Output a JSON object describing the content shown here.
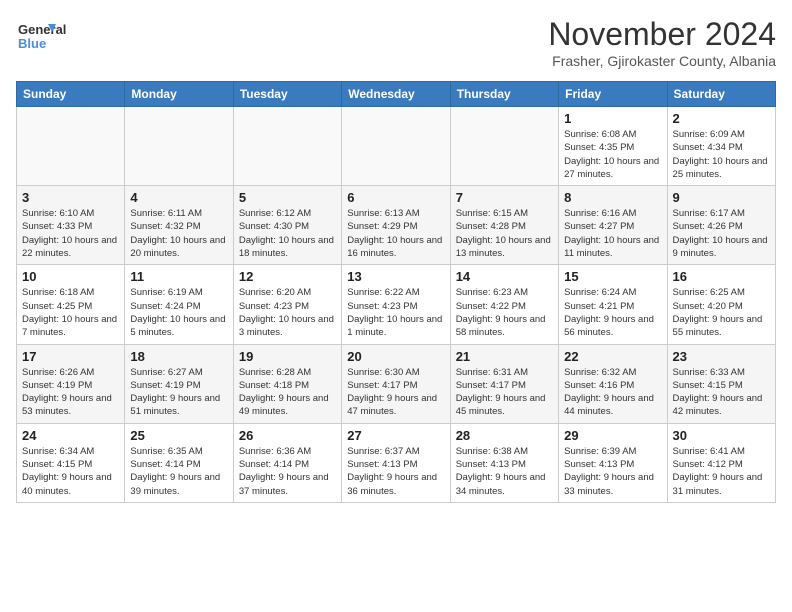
{
  "logo": {
    "line1": "General",
    "line2": "Blue"
  },
  "title": "November 2024",
  "location": "Frasher, Gjirokaster County, Albania",
  "headers": [
    "Sunday",
    "Monday",
    "Tuesday",
    "Wednesday",
    "Thursday",
    "Friday",
    "Saturday"
  ],
  "rows": [
    [
      {
        "day": "",
        "info": ""
      },
      {
        "day": "",
        "info": ""
      },
      {
        "day": "",
        "info": ""
      },
      {
        "day": "",
        "info": ""
      },
      {
        "day": "",
        "info": ""
      },
      {
        "day": "1",
        "info": "Sunrise: 6:08 AM\nSunset: 4:35 PM\nDaylight: 10 hours and 27 minutes."
      },
      {
        "day": "2",
        "info": "Sunrise: 6:09 AM\nSunset: 4:34 PM\nDaylight: 10 hours and 25 minutes."
      }
    ],
    [
      {
        "day": "3",
        "info": "Sunrise: 6:10 AM\nSunset: 4:33 PM\nDaylight: 10 hours and 22 minutes."
      },
      {
        "day": "4",
        "info": "Sunrise: 6:11 AM\nSunset: 4:32 PM\nDaylight: 10 hours and 20 minutes."
      },
      {
        "day": "5",
        "info": "Sunrise: 6:12 AM\nSunset: 4:30 PM\nDaylight: 10 hours and 18 minutes."
      },
      {
        "day": "6",
        "info": "Sunrise: 6:13 AM\nSunset: 4:29 PM\nDaylight: 10 hours and 16 minutes."
      },
      {
        "day": "7",
        "info": "Sunrise: 6:15 AM\nSunset: 4:28 PM\nDaylight: 10 hours and 13 minutes."
      },
      {
        "day": "8",
        "info": "Sunrise: 6:16 AM\nSunset: 4:27 PM\nDaylight: 10 hours and 11 minutes."
      },
      {
        "day": "9",
        "info": "Sunrise: 6:17 AM\nSunset: 4:26 PM\nDaylight: 10 hours and 9 minutes."
      }
    ],
    [
      {
        "day": "10",
        "info": "Sunrise: 6:18 AM\nSunset: 4:25 PM\nDaylight: 10 hours and 7 minutes."
      },
      {
        "day": "11",
        "info": "Sunrise: 6:19 AM\nSunset: 4:24 PM\nDaylight: 10 hours and 5 minutes."
      },
      {
        "day": "12",
        "info": "Sunrise: 6:20 AM\nSunset: 4:23 PM\nDaylight: 10 hours and 3 minutes."
      },
      {
        "day": "13",
        "info": "Sunrise: 6:22 AM\nSunset: 4:23 PM\nDaylight: 10 hours and 1 minute."
      },
      {
        "day": "14",
        "info": "Sunrise: 6:23 AM\nSunset: 4:22 PM\nDaylight: 9 hours and 58 minutes."
      },
      {
        "day": "15",
        "info": "Sunrise: 6:24 AM\nSunset: 4:21 PM\nDaylight: 9 hours and 56 minutes."
      },
      {
        "day": "16",
        "info": "Sunrise: 6:25 AM\nSunset: 4:20 PM\nDaylight: 9 hours and 55 minutes."
      }
    ],
    [
      {
        "day": "17",
        "info": "Sunrise: 6:26 AM\nSunset: 4:19 PM\nDaylight: 9 hours and 53 minutes."
      },
      {
        "day": "18",
        "info": "Sunrise: 6:27 AM\nSunset: 4:19 PM\nDaylight: 9 hours and 51 minutes."
      },
      {
        "day": "19",
        "info": "Sunrise: 6:28 AM\nSunset: 4:18 PM\nDaylight: 9 hours and 49 minutes."
      },
      {
        "day": "20",
        "info": "Sunrise: 6:30 AM\nSunset: 4:17 PM\nDaylight: 9 hours and 47 minutes."
      },
      {
        "day": "21",
        "info": "Sunrise: 6:31 AM\nSunset: 4:17 PM\nDaylight: 9 hours and 45 minutes."
      },
      {
        "day": "22",
        "info": "Sunrise: 6:32 AM\nSunset: 4:16 PM\nDaylight: 9 hours and 44 minutes."
      },
      {
        "day": "23",
        "info": "Sunrise: 6:33 AM\nSunset: 4:15 PM\nDaylight: 9 hours and 42 minutes."
      }
    ],
    [
      {
        "day": "24",
        "info": "Sunrise: 6:34 AM\nSunset: 4:15 PM\nDaylight: 9 hours and 40 minutes."
      },
      {
        "day": "25",
        "info": "Sunrise: 6:35 AM\nSunset: 4:14 PM\nDaylight: 9 hours and 39 minutes."
      },
      {
        "day": "26",
        "info": "Sunrise: 6:36 AM\nSunset: 4:14 PM\nDaylight: 9 hours and 37 minutes."
      },
      {
        "day": "27",
        "info": "Sunrise: 6:37 AM\nSunset: 4:13 PM\nDaylight: 9 hours and 36 minutes."
      },
      {
        "day": "28",
        "info": "Sunrise: 6:38 AM\nSunset: 4:13 PM\nDaylight: 9 hours and 34 minutes."
      },
      {
        "day": "29",
        "info": "Sunrise: 6:39 AM\nSunset: 4:13 PM\nDaylight: 9 hours and 33 minutes."
      },
      {
        "day": "30",
        "info": "Sunrise: 6:41 AM\nSunset: 4:12 PM\nDaylight: 9 hours and 31 minutes."
      }
    ]
  ]
}
